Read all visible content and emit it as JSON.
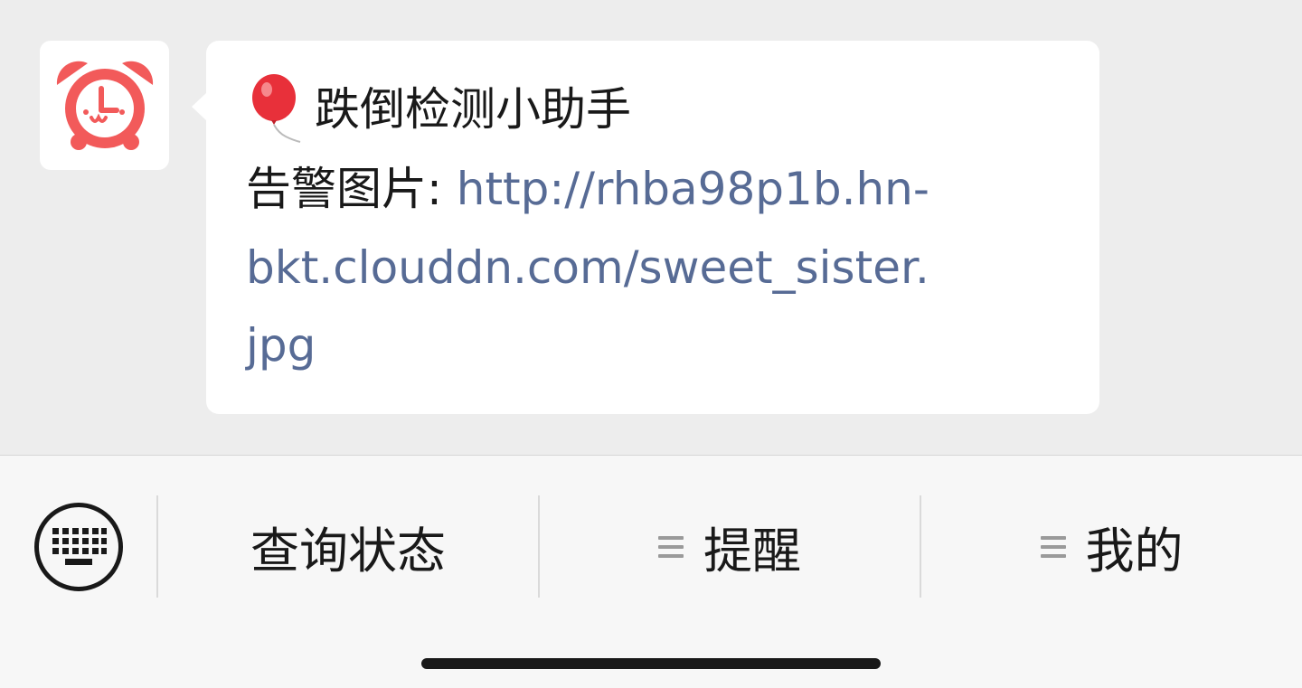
{
  "chat": {
    "sender_avatar_icon": "alarm-clock-icon",
    "message": {
      "emoji_icon": "balloon-icon",
      "title": "跌倒检测小助手",
      "image_label": "告警图片: ",
      "link_line1": "http://rhba98p1b.hn-",
      "link_line2": "bkt.clouddn.com/sweet_sister.",
      "link_line3": "jpg"
    }
  },
  "menu": {
    "keyboard_icon": "keyboard-icon",
    "items": [
      {
        "label": "查询状态",
        "icon": ""
      },
      {
        "label": "提醒",
        "icon": "menu-lines-icon"
      },
      {
        "label": "我的",
        "icon": "menu-lines-icon"
      }
    ]
  },
  "colors": {
    "background": "#ededed",
    "bubble": "#ffffff",
    "link": "#576b95",
    "avatar_red": "#f25a5a",
    "menu_bar": "#f7f7f7"
  }
}
